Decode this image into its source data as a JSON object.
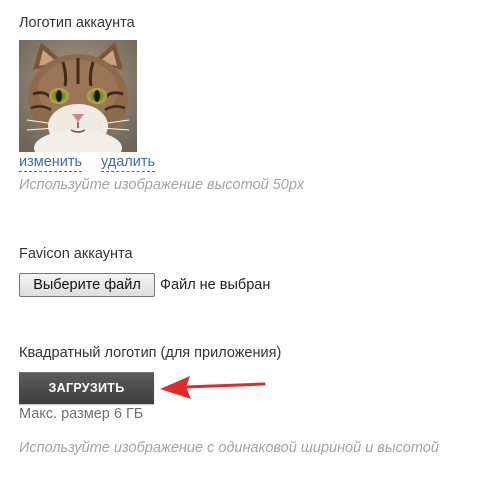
{
  "account_logo": {
    "label": "Логотип аккаунта",
    "image_icon": "cat-photo",
    "change_link": "изменить",
    "delete_link": "удалить",
    "hint": "Используйте изображение высотой 50px"
  },
  "favicon": {
    "label": "Favicon аккаунта",
    "choose_file_button": "Выберите файл",
    "file_status": "Файл не выбран"
  },
  "square_logo": {
    "label": "Квадратный логотип (для приложения)",
    "upload_button": "ЗАГРУЗИТЬ",
    "max_size": "Макс. размер 6 ГБ",
    "hint": "Используйте изображение с одинаковой шириной и высотой"
  },
  "colors": {
    "link": "#3d6ea8",
    "hint": "#a3a3a3",
    "upload_button": "#4a4a4a",
    "annotation_arrow": "#e02b2b"
  },
  "annotation": {
    "icon": "red-arrow-left-icon"
  }
}
